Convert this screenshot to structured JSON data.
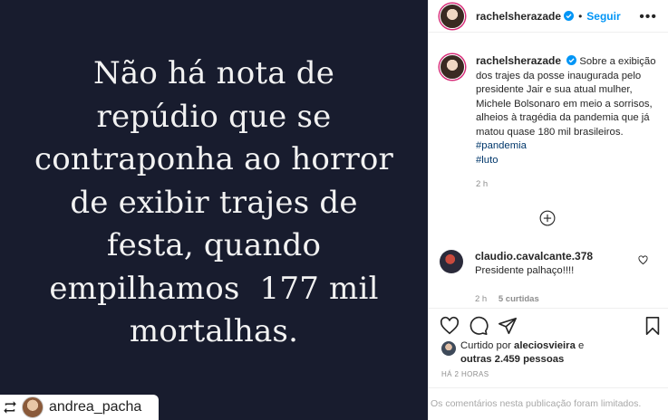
{
  "post_image": {
    "quote_lines": [
      "Não há nota de",
      "repúdio que se",
      "contraponha ao horror",
      "de exibir trajes de",
      "festa, quando",
      "empilhamos  177 mil",
      "mortalhas."
    ],
    "repost_username": "andrea_pacha"
  },
  "header": {
    "username": "rachelsherazade",
    "follow_label": "Seguir",
    "more_label": "•••"
  },
  "caption": {
    "username": "rachelsherazade",
    "text": "Sobre a exibição dos trajes da posse inaugurada pelo presidente Jair e sua atual mulher, Michele Bolsonaro em meio a sorrisos, alheios à tragédia da pandemia que já matou quase 180 mil brasileiros.",
    "hashtags": [
      "#pandemia",
      "#luto"
    ],
    "age": "2 h"
  },
  "comment": {
    "username": "claudio.cavalcante.378",
    "text": "Presidente palhaço!!!!",
    "age": "2 h",
    "likes": "5 curtidas"
  },
  "likes": {
    "prefix": "Curtido por",
    "user": "aleciosvieira",
    "conjunction": "e",
    "others": "outras 2.459 pessoas"
  },
  "timestamp": "HÁ 2 HORAS",
  "comments_limited": "Os comentários nesta publicação foram limitados.",
  "colors": {
    "image_bg": "#181c2e",
    "accent_blue": "#0095f6",
    "hashtag": "#00376b",
    "muted": "#8e8e8e"
  }
}
